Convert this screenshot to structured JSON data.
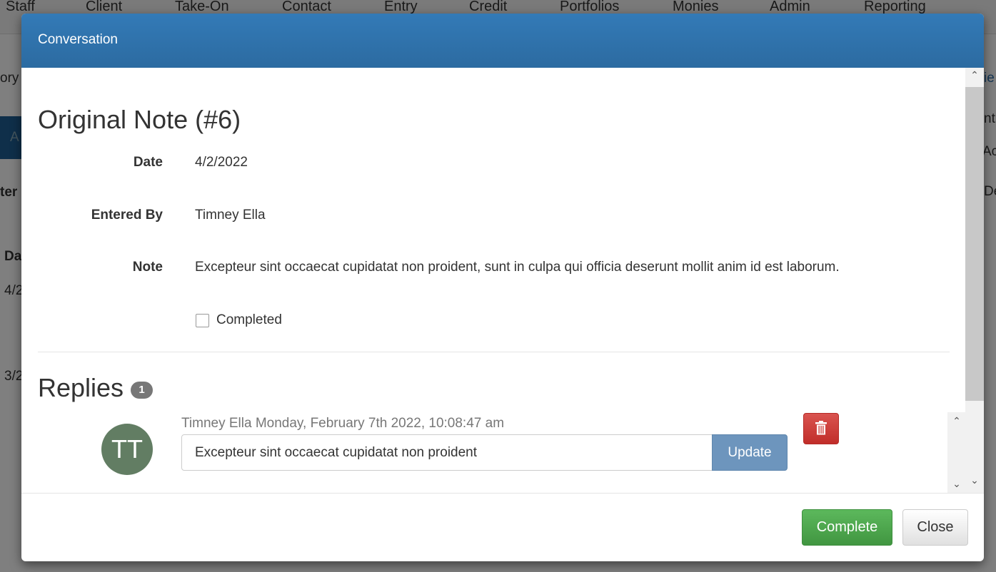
{
  "background": {
    "nav": [
      "Staff",
      "Client",
      "Take-On",
      "Contact",
      "Entry",
      "Credit",
      "Portfolios",
      "Monies",
      "Admin",
      "Reporting"
    ],
    "fragments": {
      "left1": "ory",
      "left2": "A",
      "left3": "ter",
      "left4": "Da",
      "left5": "4/2",
      "left6": "3/2",
      "right1": "ie",
      "right2": "nt",
      "right3": "Ac",
      "right4": "De"
    }
  },
  "modal": {
    "title": "Conversation",
    "original": {
      "heading": "Original Note (#6)",
      "date_label": "Date",
      "date": "4/2/2022",
      "entered_by_label": "Entered By",
      "entered_by": "Timney Ella",
      "note_label": "Note",
      "note": "Excepteur sint occaecat cupidatat non proident, sunt in culpa qui officia deserunt mollit anim id est laborum.",
      "completed_label": "Completed",
      "completed": false
    },
    "replies": {
      "heading": "Replies",
      "count": "1",
      "items": [
        {
          "initials": "TT",
          "meta": "Timney Ella Monday, February 7th 2022, 10:08:47 am",
          "text": "Excepteur sint occaecat cupidatat non proident",
          "update_label": "Update",
          "avatar_color": "#627d63"
        }
      ]
    },
    "footer": {
      "complete_label": "Complete",
      "close_label": "Close"
    }
  },
  "colors": {
    "header": "#337ab7",
    "success": "#5cb85c",
    "danger": "#d9534f"
  }
}
